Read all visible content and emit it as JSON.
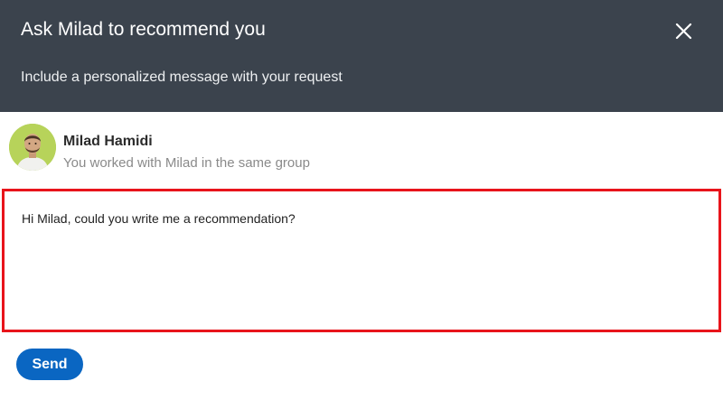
{
  "dialog": {
    "title": "Ask Milad to recommend you",
    "subtitle": "Include a personalized message with your request",
    "close_icon": "close-icon"
  },
  "person": {
    "name": "Milad Hamidi",
    "relation": "You worked with Milad in the same group"
  },
  "message": {
    "value": "Hi Milad, could you write me a recommendation?"
  },
  "actions": {
    "send_label": "Send"
  },
  "colors": {
    "header_bg": "#3b434d",
    "highlight_border": "#e8141b",
    "send_button": "#0a66c2"
  }
}
